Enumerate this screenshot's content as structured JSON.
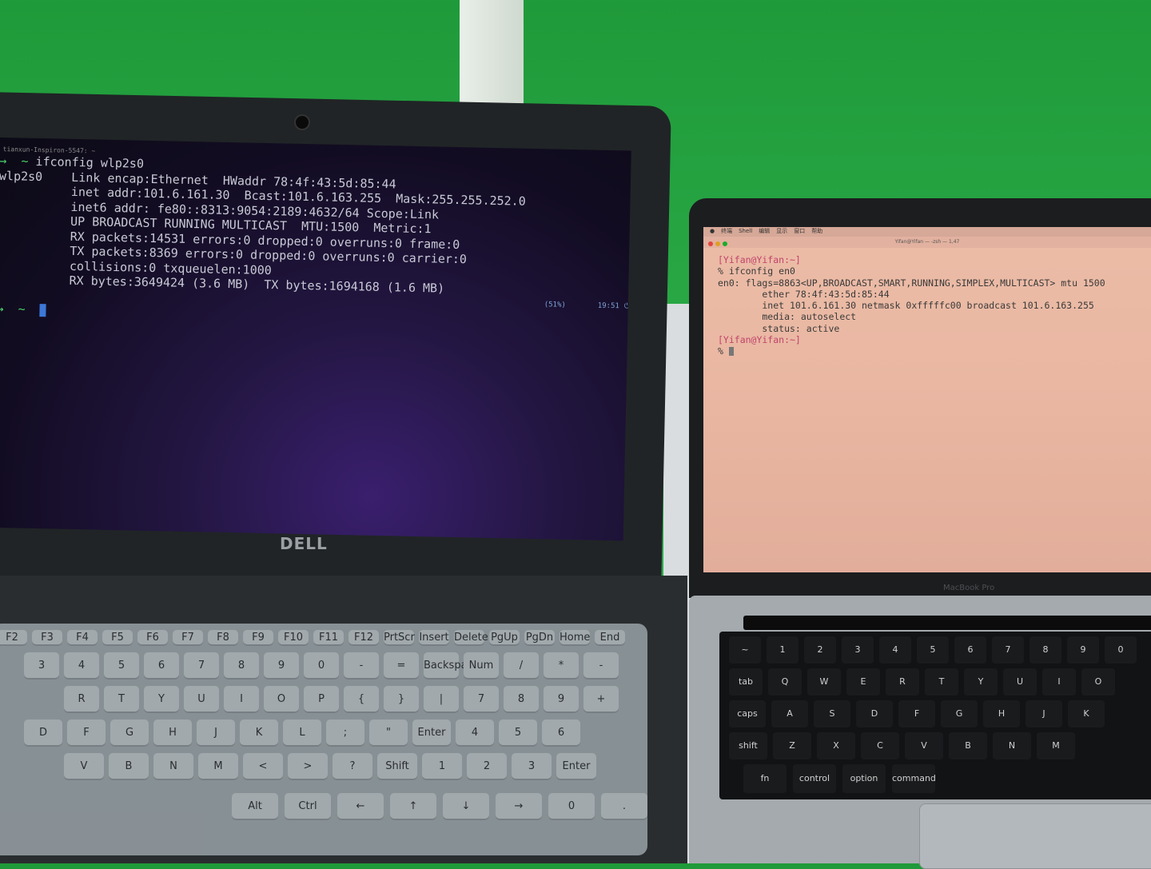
{
  "dell": {
    "window_title": "tianxun-Inspiron-5547: ~",
    "brand": "DELL",
    "tray": {
      "battery": "(51%)",
      "clock": "19:51"
    },
    "terminal_lines": [
      {
        "prefix": "→  ~ ",
        "text": "ifconfig wlp2s0"
      },
      {
        "prefix": "",
        "text": "wlp2s0    Link encap:Ethernet  HWaddr 78:4f:43:5d:85:44"
      },
      {
        "prefix": "",
        "text": "          inet addr:101.6.161.30  Bcast:101.6.163.255  Mask:255.255.252.0"
      },
      {
        "prefix": "",
        "text": "          inet6 addr: fe80::8313:9054:2189:4632/64 Scope:Link"
      },
      {
        "prefix": "",
        "text": "          UP BROADCAST RUNNING MULTICAST  MTU:1500  Metric:1"
      },
      {
        "prefix": "",
        "text": "          RX packets:14531 errors:0 dropped:0 overruns:0 frame:0"
      },
      {
        "prefix": "",
        "text": "          TX packets:8369 errors:0 dropped:0 overruns:0 carrier:0"
      },
      {
        "prefix": "",
        "text": "          collisions:0 txqueuelen:1000"
      },
      {
        "prefix": "",
        "text": "          RX bytes:3649424 (3.6 MB)  TX bytes:1694168 (1.6 MB)"
      },
      {
        "prefix": "",
        "text": ""
      },
      {
        "prefix": "→  ~ ",
        "text": ""
      }
    ],
    "keys": {
      "fn_row": [
        "F2",
        "F3",
        "F4",
        "F5",
        "F6",
        "F7",
        "F8",
        "F9",
        "F10",
        "F11",
        "F12",
        "PrtScr",
        "Insert",
        "Delete",
        "PgUp",
        "PgDn",
        "Home",
        "End"
      ],
      "num_row": [
        "3",
        "4",
        "5",
        "6",
        "7",
        "8",
        "9",
        "0",
        "-",
        "=",
        "Backspace",
        "Num Lock",
        "/",
        "*",
        "-"
      ],
      "row_q": [
        "R",
        "T",
        "Y",
        "U",
        "I",
        "O",
        "P",
        "{",
        "}",
        "|",
        "7",
        "8",
        "9",
        "+"
      ],
      "row_a": [
        "D",
        "F",
        "G",
        "H",
        "J",
        "K",
        "L",
        ";",
        "\"",
        "Enter",
        "4",
        "5",
        "6"
      ],
      "row_z": [
        "V",
        "B",
        "N",
        "M",
        "<",
        ">",
        "?",
        "Shift",
        "1",
        "2",
        "3",
        "Enter"
      ],
      "row_space": [
        "Alt",
        "Ctrl",
        "←",
        "↑",
        "↓",
        "→",
        "0",
        "."
      ]
    }
  },
  "mac": {
    "menu_items": [
      "终端",
      "Shell",
      "编辑",
      "显示",
      "窗口",
      "帮助"
    ],
    "window_title": "Yifan@Yifan — -zsh — 1,47",
    "model": "MacBook Pro",
    "prompt_user": "[Yifan@Yifan:~]",
    "terminal_lines": [
      "% ifconfig en0",
      "en0: flags=8863<UP,BROADCAST,SMART,RUNNING,SIMPLEX,MULTICAST> mtu 1500",
      "        ether 78:4f:43:5d:85:44",
      "        inet 101.6.161.30 netmask 0xfffffc00 broadcast 101.6.163.255",
      "        media: autoselect",
      "        status: active"
    ],
    "final_prompt": "%",
    "keys": {
      "num_row": [
        "~",
        "1",
        "2",
        "3",
        "4",
        "5",
        "6",
        "7",
        "8",
        "9",
        "0"
      ],
      "row_q": [
        "tab",
        "Q",
        "W",
        "E",
        "R",
        "T",
        "Y",
        "U",
        "I",
        "O"
      ],
      "row_a": [
        "caps lock",
        "A",
        "S",
        "D",
        "F",
        "G",
        "H",
        "J",
        "K"
      ],
      "row_z": [
        "shift",
        "Z",
        "X",
        "C",
        "V",
        "B",
        "N",
        "M"
      ],
      "row_mod": [
        "fn",
        "control",
        "option",
        "command"
      ]
    }
  },
  "colors": {
    "wall": "#2aa946",
    "mac_screen": "#e9b7a2",
    "dell_screen": "#1a1230"
  }
}
